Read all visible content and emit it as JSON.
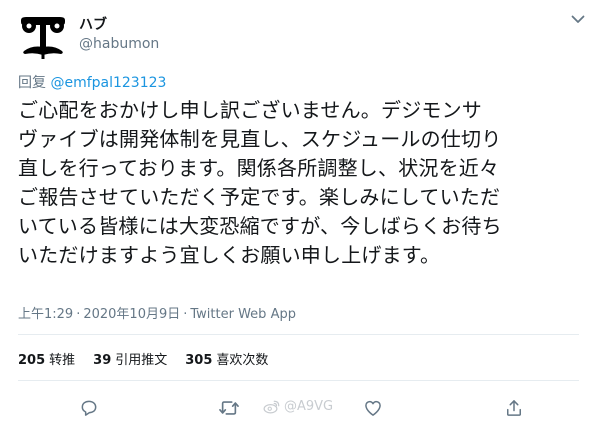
{
  "user": {
    "display_name": "ハブ",
    "handle": "@habumon",
    "avatar": "stylized-face-logo"
  },
  "reply": {
    "prefix": "回复",
    "mention": "@emfpal123123"
  },
  "tweet": {
    "lines": [
      "ご心配をおかけし申し訳ございません。デジモンサ",
      "ヴァイブは開発体制を見直し、スケジュールの仕切り",
      "直しを行っております。関係各所調整し、状況を近々",
      "ご報告させていただく予定です。楽しみにしていただ",
      "いている皆様には大変恐縮ですが、今しばらくお待ち",
      "いただけますよう宜しくお願い申し上げます。"
    ]
  },
  "meta": {
    "time": "上午1:29",
    "separator": "·",
    "date": "2020年10月9日",
    "source": "Twitter Web App"
  },
  "stats": {
    "retweets_count": "205",
    "retweets_label": "转推",
    "quotes_count": "39",
    "quotes_label": "引用推文",
    "likes_count": "305",
    "likes_label": "喜欢次数"
  },
  "actions": {
    "icons": [
      "reply-icon",
      "retweet-icon",
      "like-icon",
      "share-icon"
    ]
  },
  "watermark": {
    "text": "@A9VG",
    "icon": "weibo-icon"
  },
  "colors": {
    "text": "#14171a",
    "secondary": "#657786",
    "link": "#1b95e0",
    "divider": "#e6ecf0"
  }
}
